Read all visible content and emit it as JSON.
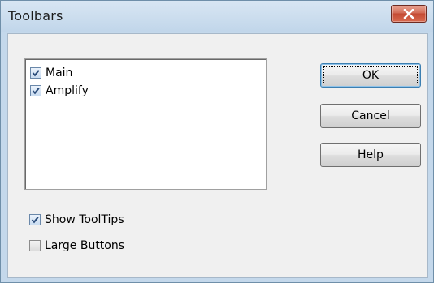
{
  "window": {
    "title": "Toolbars"
  },
  "toolbars_list": {
    "items": [
      {
        "label": "Main",
        "checked": true
      },
      {
        "label": "Amplify",
        "checked": true
      }
    ]
  },
  "options": {
    "show_tooltips": {
      "label": "Show ToolTips",
      "mnemonic": "p",
      "checked": true
    },
    "large_buttons": {
      "label": "Large Buttons",
      "mnemonic": "L",
      "checked": false
    }
  },
  "buttons": {
    "ok": "OK",
    "cancel": "Cancel",
    "help": "Help"
  },
  "icons": {
    "close": "close-icon",
    "check": "checkmark-icon"
  },
  "colors": {
    "titlebar": "#c4d8eb",
    "client": "#f0f0f0",
    "close_button": "#c9513b",
    "check": "#2a4c7a"
  }
}
